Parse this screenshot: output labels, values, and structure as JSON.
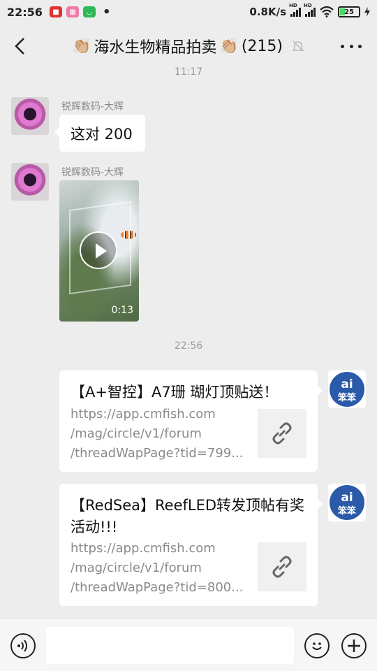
{
  "status_bar": {
    "time": "22:56",
    "net_speed": "0.8K/s",
    "hd_label": "HD",
    "battery": "25",
    "dot": "•"
  },
  "header": {
    "title": "海水生物精品拍卖",
    "member_count": "(215)",
    "clap_emoji": "👏🏼"
  },
  "timestamps": [
    "11:17",
    "22:56"
  ],
  "messages": [
    {
      "sender": "锐辉数码-大辉",
      "text": "这对 200"
    },
    {
      "sender": "锐辉数码-大辉",
      "video_duration": "0:13"
    }
  ],
  "links": [
    {
      "title": "【A+智控】A7珊 瑚灯顶贴送！",
      "url_lines": [
        "https://app.cmfish.com",
        "/mag/circle/v1/forum",
        "/threadWapPage?tid=799..."
      ]
    },
    {
      "title": "【RedSea】ReefLED转发顶帖有奖活动!!!",
      "url_lines": [
        "https://app.cmfish.com",
        "/mag/circle/v1/forum",
        "/threadWapPage?tid=800..."
      ]
    }
  ],
  "avatar_text": {
    "top": "ai",
    "bottom": "笨笨"
  },
  "colors": {
    "background": "#ededed",
    "bubble": "#ffffff",
    "avatar_blue": "#2b5aa8",
    "battery_green": "#4cd964"
  },
  "icons": [
    "back-icon",
    "more-icon",
    "mute-bell-icon",
    "play-icon",
    "link-icon",
    "voice-icon",
    "emoji-icon",
    "plus-icon"
  ]
}
